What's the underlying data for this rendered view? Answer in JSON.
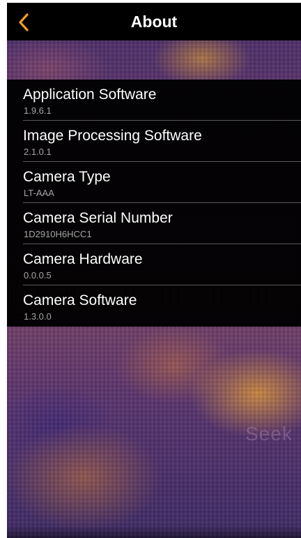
{
  "header": {
    "title": "About",
    "back_icon": "chevron-left-icon",
    "accent_color": "#f0a020"
  },
  "about_items": [
    {
      "label": "Application Software",
      "value": "1.9.6.1"
    },
    {
      "label": "Image Processing Software",
      "value": "2.1.0.1"
    },
    {
      "label": "Camera Type",
      "value": "LT-AAA"
    },
    {
      "label": "Camera Serial Number",
      "value": "1D2910H6HCC1"
    },
    {
      "label": "Camera Hardware",
      "value": "0.0.0.5"
    },
    {
      "label": "Camera Software",
      "value": "1.3.0.0"
    }
  ],
  "background": {
    "watermark": "Seek"
  }
}
